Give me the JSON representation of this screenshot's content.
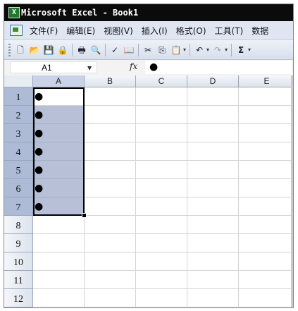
{
  "window": {
    "title": "Microsoft Excel - Book1",
    "app_icon_letter": "X"
  },
  "menu": {
    "items": [
      "文件(F)",
      "编辑(E)",
      "视图(V)",
      "插入(I)",
      "格式(O)",
      "工具(T)",
      "数据"
    ]
  },
  "toolbar": {
    "buttons": [
      {
        "name": "new-icon",
        "glyph": "🗋"
      },
      {
        "name": "open-icon",
        "glyph": "📂"
      },
      {
        "name": "save-icon",
        "glyph": "💾"
      },
      {
        "name": "permission-icon",
        "glyph": "🔒"
      },
      {
        "name": "print-icon",
        "glyph": "🖶"
      },
      {
        "name": "print-preview-icon",
        "glyph": "🔍"
      },
      {
        "name": "spelling-icon",
        "glyph": "✓"
      },
      {
        "name": "research-icon",
        "glyph": "📖"
      },
      {
        "name": "cut-icon",
        "glyph": "✂"
      },
      {
        "name": "copy-icon",
        "glyph": "⎘"
      },
      {
        "name": "paste-icon",
        "glyph": "📋"
      },
      {
        "name": "undo-icon",
        "glyph": "↶"
      },
      {
        "name": "redo-icon",
        "glyph": "↷"
      },
      {
        "name": "autosum-icon",
        "glyph": "Σ"
      }
    ]
  },
  "formula_bar": {
    "name_box": "A1",
    "fx_label": "fx",
    "content": "●"
  },
  "sheet": {
    "columns": [
      "A",
      "B",
      "C",
      "D",
      "E"
    ],
    "rows": [
      "1",
      "2",
      "3",
      "4",
      "5",
      "6",
      "7",
      "8",
      "9",
      "10",
      "11",
      "12"
    ],
    "selected_column": "A",
    "selected_rows": [
      "1",
      "2",
      "3",
      "4",
      "5",
      "6",
      "7"
    ],
    "column_a_values": [
      "●",
      "●",
      "●",
      "●",
      "●",
      "●",
      "●",
      "",
      "",
      "",
      "",
      ""
    ]
  },
  "colors": {
    "titlebar": "#0b0b0b",
    "selection": "#b8c0d8",
    "menubar": "#dfe6f2"
  }
}
